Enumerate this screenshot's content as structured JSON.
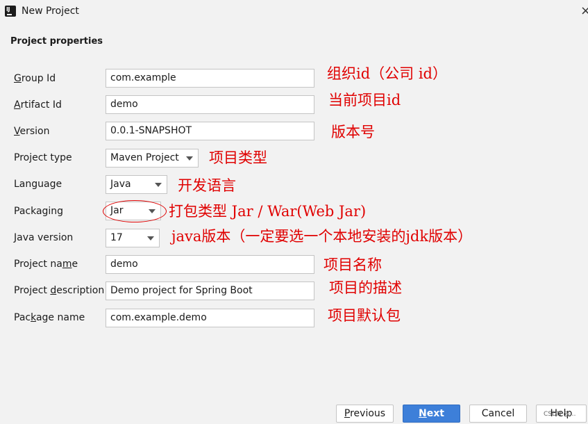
{
  "window": {
    "title": "New Project",
    "icon": "intellij-idea-icon",
    "close_glyph": "×"
  },
  "section_title": "Project properties",
  "fields": {
    "group_id": {
      "label_u": "G",
      "label_rest": "roup Id",
      "value": "com.example"
    },
    "artifact_id": {
      "label_u": "A",
      "label_rest": "rtifact Id",
      "value": "demo"
    },
    "version": {
      "label_u": "V",
      "label_rest": "ersion",
      "value": "0.0.1-SNAPSHOT"
    },
    "project_type": {
      "label": "Project type",
      "value": "Maven Project"
    },
    "language": {
      "label": "Language",
      "value": "Java"
    },
    "packaging": {
      "label": "Packaging",
      "value": "Jar"
    },
    "java_version": {
      "label": "Java version",
      "value": "17"
    },
    "project_name": {
      "label_pre": "Project na",
      "label_u": "m",
      "label_rest": "e",
      "value": "demo"
    },
    "project_description": {
      "label_pre": "Project ",
      "label_u": "d",
      "label_rest": "escription",
      "value": "Demo project for Spring Boot"
    },
    "package_name": {
      "label_pre": "Pac",
      "label_u": "k",
      "label_rest": "age name",
      "value": "com.example.demo"
    }
  },
  "annotations": {
    "group_id": "组织id（公司 id）",
    "artifact_id": "当前项目id",
    "version": "版本号",
    "project_type": "项目类型",
    "language": "开发语言",
    "packaging": "打包类型  Jar / War(Web Jar)",
    "java_version": "java版本（一定要选一个本地安装的jdk版本）",
    "project_name": "项目名称",
    "project_description": "项目的描述",
    "package_name": "项目默认包"
  },
  "buttons": {
    "previous": {
      "u": "P",
      "rest": "revious"
    },
    "next": {
      "u": "N",
      "rest": "ext"
    },
    "cancel": "Cancel",
    "help": "Help"
  },
  "watermark": "CSDN @…",
  "colors": {
    "accent": "#3d7fd9",
    "annotation": "#e00000",
    "background": "#f2f2f2"
  }
}
